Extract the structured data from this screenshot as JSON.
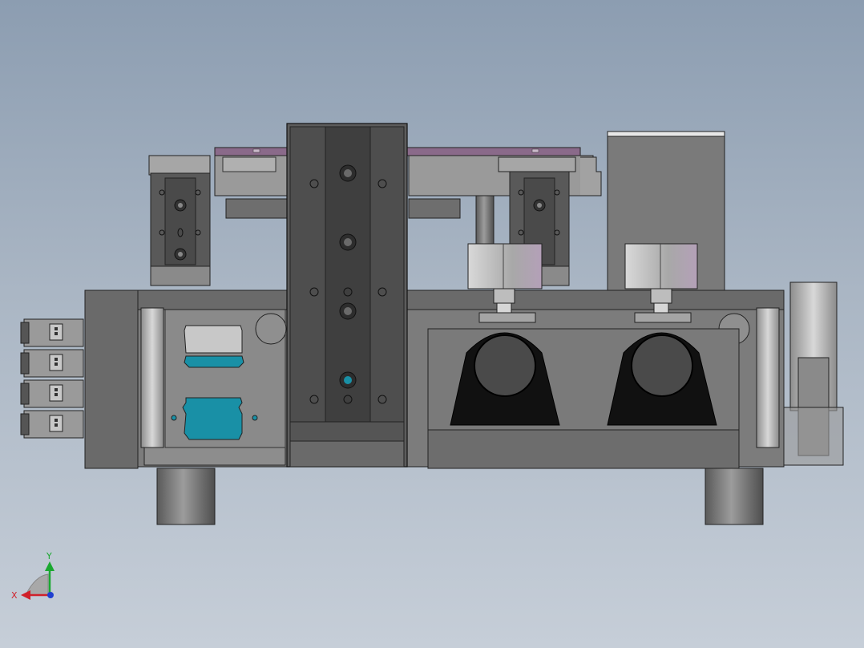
{
  "viewport": {
    "background_top": "#8c9db1",
    "background_bottom": "#c6ced8"
  },
  "model": {
    "description_icon": "cad-assembly-front-view",
    "colors": {
      "steel_dark": "#4a4a4a",
      "steel_mid": "#6e6e6e",
      "steel_light": "#9a9a9a",
      "rail_purple": "#8a6a8a",
      "highlight_cyan": "#1990a6",
      "bearing_black": "#111111"
    }
  },
  "triad": {
    "x_label": "X",
    "y_label": "Y",
    "x_color": "#d0202a",
    "y_color": "#1aa830",
    "z_color": "#1f3fd0"
  }
}
